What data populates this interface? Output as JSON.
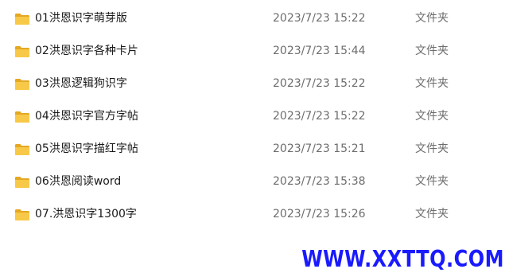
{
  "files": [
    {
      "name": "01洪恩识字萌芽版",
      "modified": "2023/7/23 15:22",
      "type": "文件夹",
      "icon": "folder-icon"
    },
    {
      "name": "02洪恩识字各种卡片",
      "modified": "2023/7/23 15:44",
      "type": "文件夹",
      "icon": "folder-icon"
    },
    {
      "name": "03洪恩逻辑狗识字",
      "modified": "2023/7/23 15:22",
      "type": "文件夹",
      "icon": "folder-icon"
    },
    {
      "name": "04洪恩识字官方字帖",
      "modified": "2023/7/23 15:22",
      "type": "文件夹",
      "icon": "folder-icon"
    },
    {
      "name": "05洪恩识字描红字帖",
      "modified": "2023/7/23 15:21",
      "type": "文件夹",
      "icon": "folder-icon"
    },
    {
      "name": "06洪恩阅读word",
      "modified": "2023/7/23 15:38",
      "type": "文件夹",
      "icon": "folder-icon"
    },
    {
      "name": "07.洪恩识字1300字",
      "modified": "2023/7/23 15:26",
      "type": "文件夹",
      "icon": "folder-icon"
    }
  ],
  "watermark": {
    "text": "WWW.XXTTQ.COM",
    "color": "#1a1aff"
  },
  "colors": {
    "folder_body": "#f8c948",
    "folder_tab": "#e4a823",
    "secondary_text": "#6d6d6d"
  }
}
